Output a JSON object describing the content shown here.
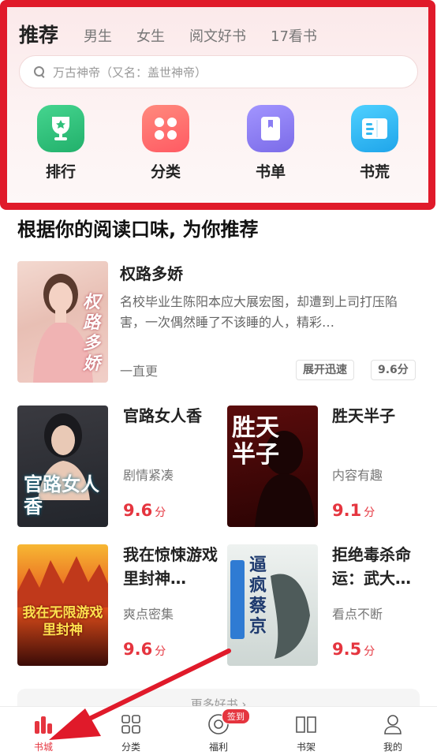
{
  "header": {
    "tabs": [
      "推荐",
      "男生",
      "女生",
      "阅文好书",
      "17看书"
    ],
    "search_placeholder": "万古神帝（又名：盖世神帝）",
    "quick_links": [
      {
        "label": "排行",
        "icon": "trophy-icon",
        "color": "#2fc07a"
      },
      {
        "label": "分类",
        "icon": "grid-icon",
        "color": "#ff6f6f"
      },
      {
        "label": "书单",
        "icon": "booklist-icon",
        "color": "#8a7df3"
      },
      {
        "label": "书荒",
        "icon": "open-book-icon",
        "color": "#32b8f0"
      }
    ]
  },
  "section_title": "根据你的阅读口味, 为你推荐",
  "featured": {
    "title": "权路多娇",
    "desc": "名校毕业生陈阳本应大展宏图，却遭到上司打压陷害，一次偶然睡了不该睡的人，精彩…",
    "author": "一直更",
    "tags": [
      "展开迅速",
      "9.6分"
    ],
    "cover_text": "权路多娇"
  },
  "grid": [
    {
      "title": "官路女人香",
      "sub": "剧情紧凑",
      "score": "9.6",
      "unit": "分",
      "cover_text": "官路女人香"
    },
    {
      "title": "胜天半子",
      "sub": "内容有趣",
      "score": "9.1",
      "unit": "分",
      "cover_text": "胜天半子"
    },
    {
      "title": "我在惊悚游戏里封神…",
      "sub": "爽点密集",
      "score": "9.6",
      "unit": "分",
      "cover_text": "我在无限游戏里封神"
    },
    {
      "title": "拒绝毒杀命运：武大…",
      "sub": "看点不断",
      "score": "9.5",
      "unit": "分",
      "cover_text": "逼疯蔡京"
    }
  ],
  "more_label": "更多好书 ›",
  "tabbar": {
    "items": [
      {
        "label": "书城",
        "icon": "bookstore-icon"
      },
      {
        "label": "分类",
        "icon": "category-icon"
      },
      {
        "label": "福利",
        "icon": "coin-icon",
        "badge": "签到"
      },
      {
        "label": "书架",
        "icon": "bookshelf-icon"
      },
      {
        "label": "我的",
        "icon": "profile-icon"
      }
    ]
  },
  "colors": {
    "accent": "#e5353f",
    "highlight_border": "#e01a2a"
  }
}
